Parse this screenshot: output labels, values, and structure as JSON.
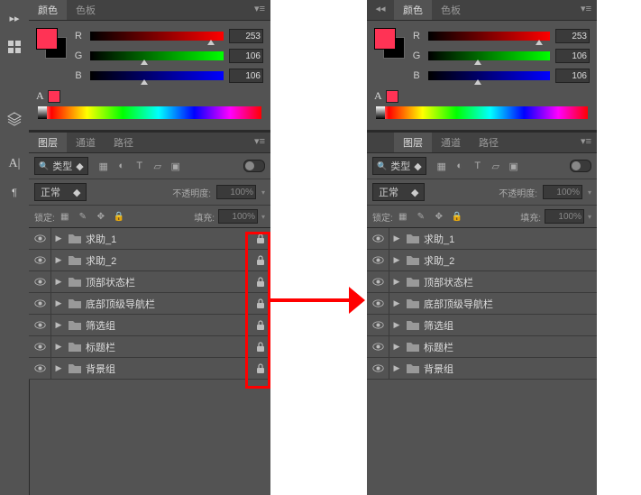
{
  "color_panel": {
    "tabs": {
      "color": "颜色",
      "swatches": "色板"
    },
    "channels": {
      "r": "R",
      "g": "G",
      "b": "B"
    },
    "values": {
      "r": "253",
      "g": "106",
      "b": "106"
    },
    "thumb_pos": {
      "r": 88,
      "g": 38,
      "b": 38
    }
  },
  "layers_panel": {
    "tabs": {
      "layers": "图层",
      "channels": "通道",
      "paths": "路径"
    },
    "kind_label": "类型",
    "blend_mode": "正常",
    "opacity_label": "不透明度:",
    "opacity_value": "100%",
    "lock_label": "锁定:",
    "fill_label": "填充:",
    "fill_value": "100%"
  },
  "layers": [
    {
      "name": "求助_1"
    },
    {
      "name": "求助_2"
    },
    {
      "name": "顶部状态栏"
    },
    {
      "name": "底部顶级导航栏"
    },
    {
      "name": "筛选组"
    },
    {
      "name": "标题栏"
    },
    {
      "name": "背景组"
    }
  ]
}
